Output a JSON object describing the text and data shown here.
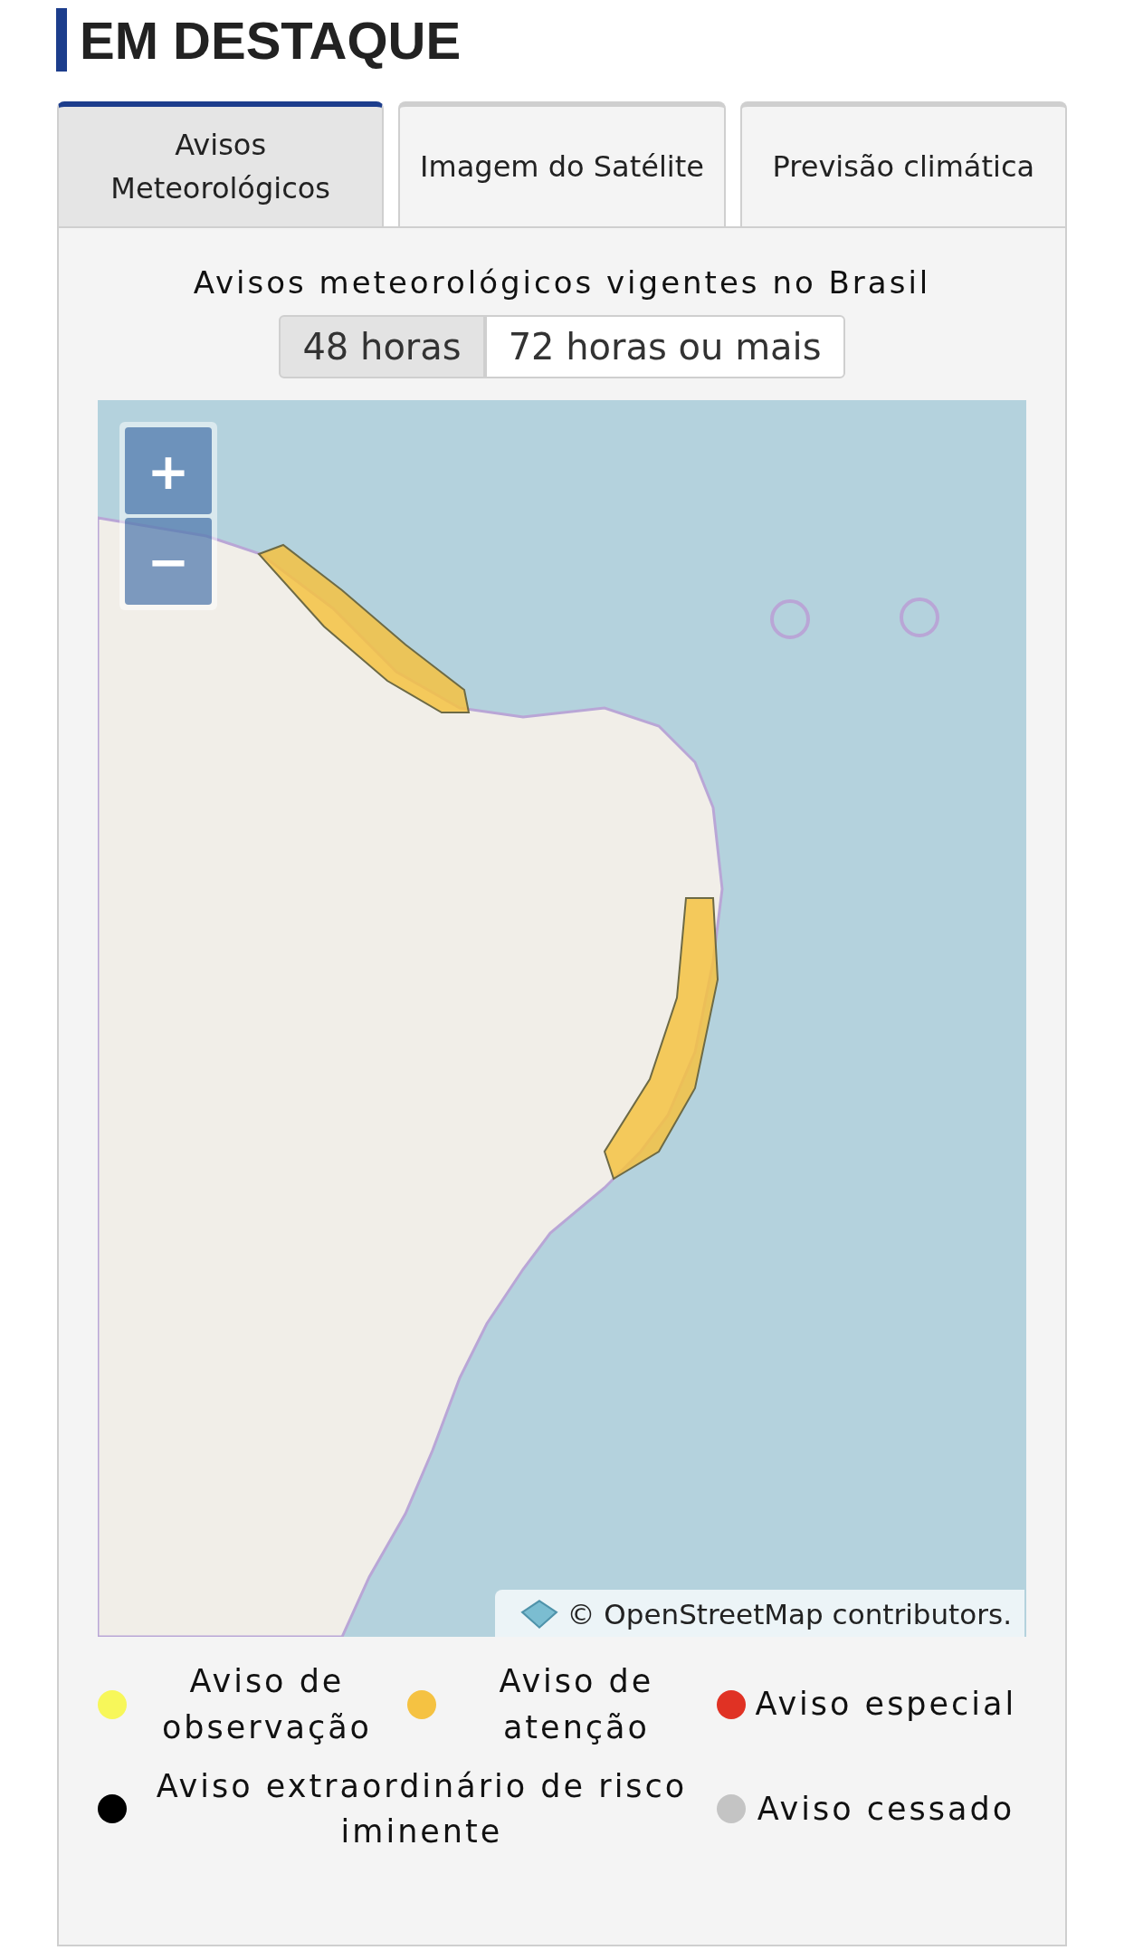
{
  "section_title": "EM DESTAQUE",
  "tabs": [
    {
      "label": "Avisos Meteorológicos",
      "selected": true
    },
    {
      "label": "Imagem do Satélite",
      "selected": false
    },
    {
      "label": "Previsão climática",
      "selected": false
    }
  ],
  "heading": "Avisos meteorológicos vigentes no Brasil",
  "range_options": [
    {
      "label": "48 horas",
      "selected": true
    },
    {
      "label": "72 horas ou mais",
      "selected": false
    }
  ],
  "map": {
    "zoom_in": "+",
    "zoom_out": "−",
    "attribution": "© OpenStreetMap contributors."
  },
  "legend": [
    {
      "label": "Aviso de observação",
      "color": "#f7f75a"
    },
    {
      "label": "Aviso de atenção",
      "color": "#f5c242"
    },
    {
      "label": "Aviso especial",
      "color": "#e03224"
    },
    {
      "label": "Aviso extraordinário de risco iminente",
      "color": "#000000"
    },
    {
      "label": "Aviso cessado",
      "color": "#c4c4c4"
    }
  ]
}
